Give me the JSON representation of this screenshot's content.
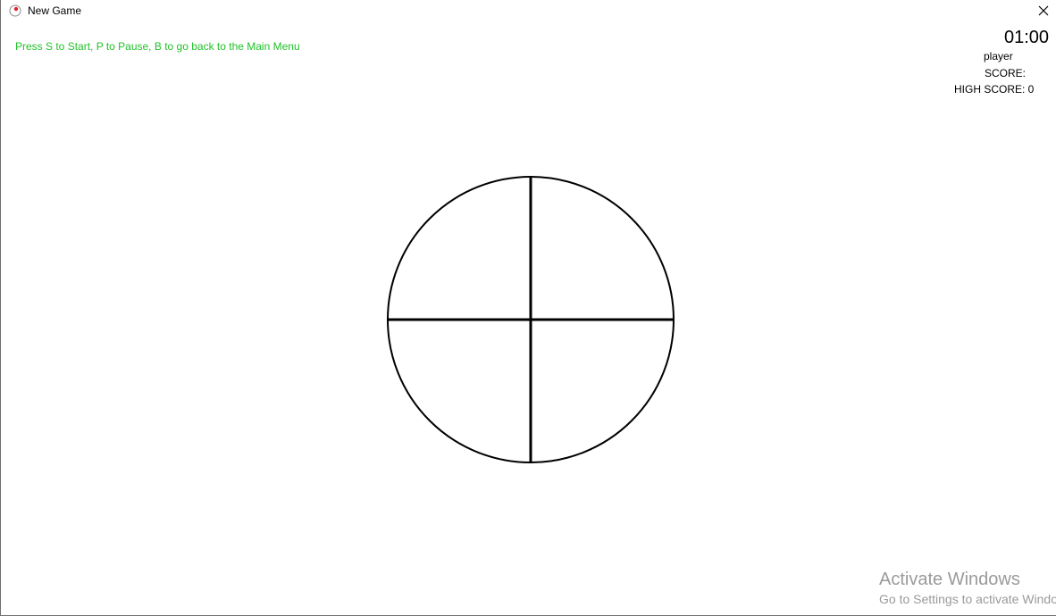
{
  "window": {
    "title": "New Game",
    "app_icon": "target-icon",
    "close_icon": "close-icon"
  },
  "game": {
    "instructions": "Press S to Start, P to Pause, B to go back to the Main Menu",
    "instructions_color": "#22c12a",
    "timer": "01:00",
    "player": "player",
    "score_label": "SCORE:",
    "high_score": "HIGH SCORE: 0",
    "target_icon": "crosshair-circle"
  },
  "watermark": {
    "title": "Activate Windows",
    "subtitle": "Go to Settings to activate Windows."
  }
}
